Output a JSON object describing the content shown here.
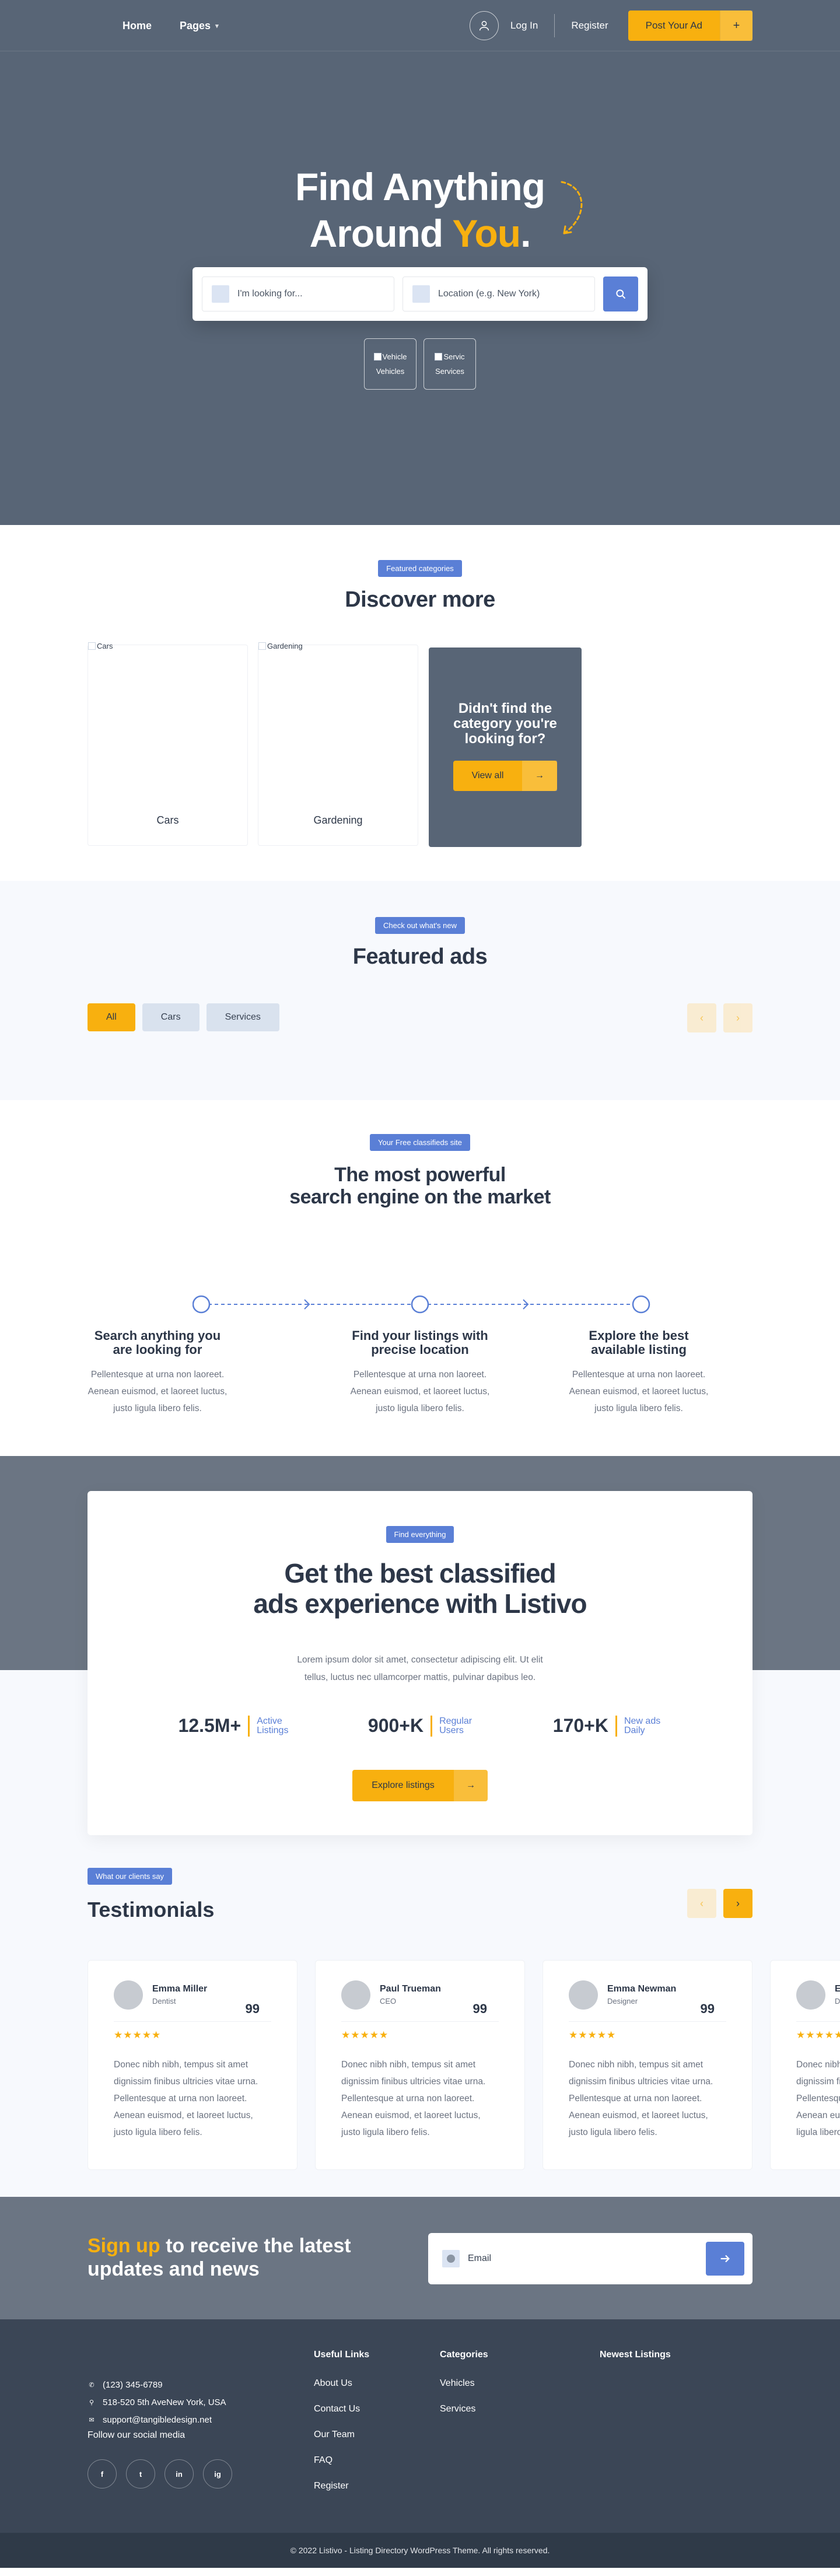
{
  "nav": {
    "home": "Home",
    "pages": "Pages",
    "login": "Log In",
    "register": "Register",
    "post_ad": "Post Your Ad"
  },
  "hero": {
    "title_line1": "Find Anything",
    "title_line2_a": "Around ",
    "title_line2_you": "You",
    "title_line2_dot": ".",
    "search_placeholder": "I'm looking for...",
    "location_placeholder": "Location (e.g. New York)",
    "categories": [
      {
        "alt": "Vehicle",
        "label": "Vehicles"
      },
      {
        "alt": "Servic",
        "label": "Services"
      }
    ]
  },
  "discover": {
    "badge": "Featured categories",
    "title": "Discover more",
    "cards": [
      {
        "alt": "Cars",
        "label": "Cars"
      },
      {
        "alt": "Gardening",
        "label": "Gardening"
      }
    ],
    "cta_title": "Didn't find the category you're looking for?",
    "cta_button": "View all"
  },
  "featured": {
    "badge": "Check out what's new",
    "title": "Featured ads",
    "filters": [
      "All",
      "Cars",
      "Services"
    ]
  },
  "powerful": {
    "badge": "Your Free classifieds site",
    "title_line1": "The most powerful",
    "title_line2": "search engine on the market",
    "steps": [
      {
        "title": "Search anything you are looking for",
        "text": "Pellentesque at urna non laoreet. Aenean euismod, et laoreet luctus, justo ligula libero felis."
      },
      {
        "title": "Find your listings with precise location",
        "text": "Pellentesque at urna non laoreet. Aenean euismod, et laoreet luctus, justo ligula libero felis."
      },
      {
        "title": "Explore the best available listing",
        "text": "Pellentesque at urna non laoreet. Aenean euismod, et laoreet luctus, justo ligula libero felis."
      }
    ]
  },
  "getbest": {
    "badge": "Find everything",
    "title_line1": "Get the best classified",
    "title_line2": "ads experience with Listivo",
    "desc_line1": "Lorem ipsum dolor sit amet, consectetur adipiscing elit. Ut elit",
    "desc_line2": "tellus, luctus nec ullamcorper mattis, pulvinar dapibus leo.",
    "stats": [
      {
        "num": "12.5M+",
        "l1": "Active",
        "l2": "Listings"
      },
      {
        "num": "900+K",
        "l1": "Regular",
        "l2": "Users"
      },
      {
        "num": "170+K",
        "l1": "New ads",
        "l2": "Daily"
      }
    ],
    "explore": "Explore listings"
  },
  "testimonials": {
    "badge": "What our clients say",
    "title": "Testimonials",
    "cards": [
      {
        "name": "Emma Miller",
        "role": "Dentist",
        "quote": "99",
        "stars": "★★★★★",
        "text": "Donec nibh nibh, tempus sit amet dignissim finibus ultricies vitae urna. Pellentesque at urna non laoreet. Aenean euismod, et laoreet luctus, justo ligula libero felis."
      },
      {
        "name": "Paul Trueman",
        "role": "CEO",
        "quote": "99",
        "stars": "★★★★★",
        "text": "Donec nibh nibh, tempus sit amet dignissim finibus ultricies vitae urna. Pellentesque at urna non laoreet. Aenean euismod, et laoreet luctus, justo ligula libero felis."
      },
      {
        "name": "Emma Newman",
        "role": "Designer",
        "quote": "99",
        "stars": "★★★★★",
        "text": "Donec nibh nibh, tempus sit amet dignissim finibus ultricies vitae urna. Pellentesque at urna non laoreet. Aenean euismod, et laoreet luctus, justo ligula libero felis."
      },
      {
        "name": "E",
        "role": "D",
        "quote": "",
        "stars": "★★★★★",
        "text": "Donec nibh nibh, tempus sit amet dignissim finibus ultricies vitae urna. Pellentesque at urna non laoreet. Aenean euismod, et laoreet luctus, justo ligula libero felis."
      }
    ]
  },
  "newsletter": {
    "highlight": "Sign up",
    "rest_line1": " to receive the latest",
    "line2": "updates and news",
    "email_placeholder": "Email"
  },
  "footer": {
    "phone": "(123) 345-6789",
    "address": "518-520 5th AveNew York, USA",
    "email": "support@tangibledesign.net",
    "follow": "Follow our social media",
    "social": [
      "f",
      "t",
      "in",
      "ig"
    ],
    "useful_title": "Useful Links",
    "useful": [
      "About Us",
      "Contact Us",
      "Our Team",
      "FAQ",
      "Register"
    ],
    "categories_title": "Categories",
    "categories": [
      "Vehicles",
      "Services"
    ],
    "newest_title": "Newest Listings",
    "copyright": "© 2022 Listivo - Listing Directory WordPress Theme. All rights reserved."
  },
  "colors": {
    "accent": "#f8b00f",
    "primary": "#5a7fd6",
    "hero_bg": "#586576",
    "footer_bg": "#3b4656"
  }
}
